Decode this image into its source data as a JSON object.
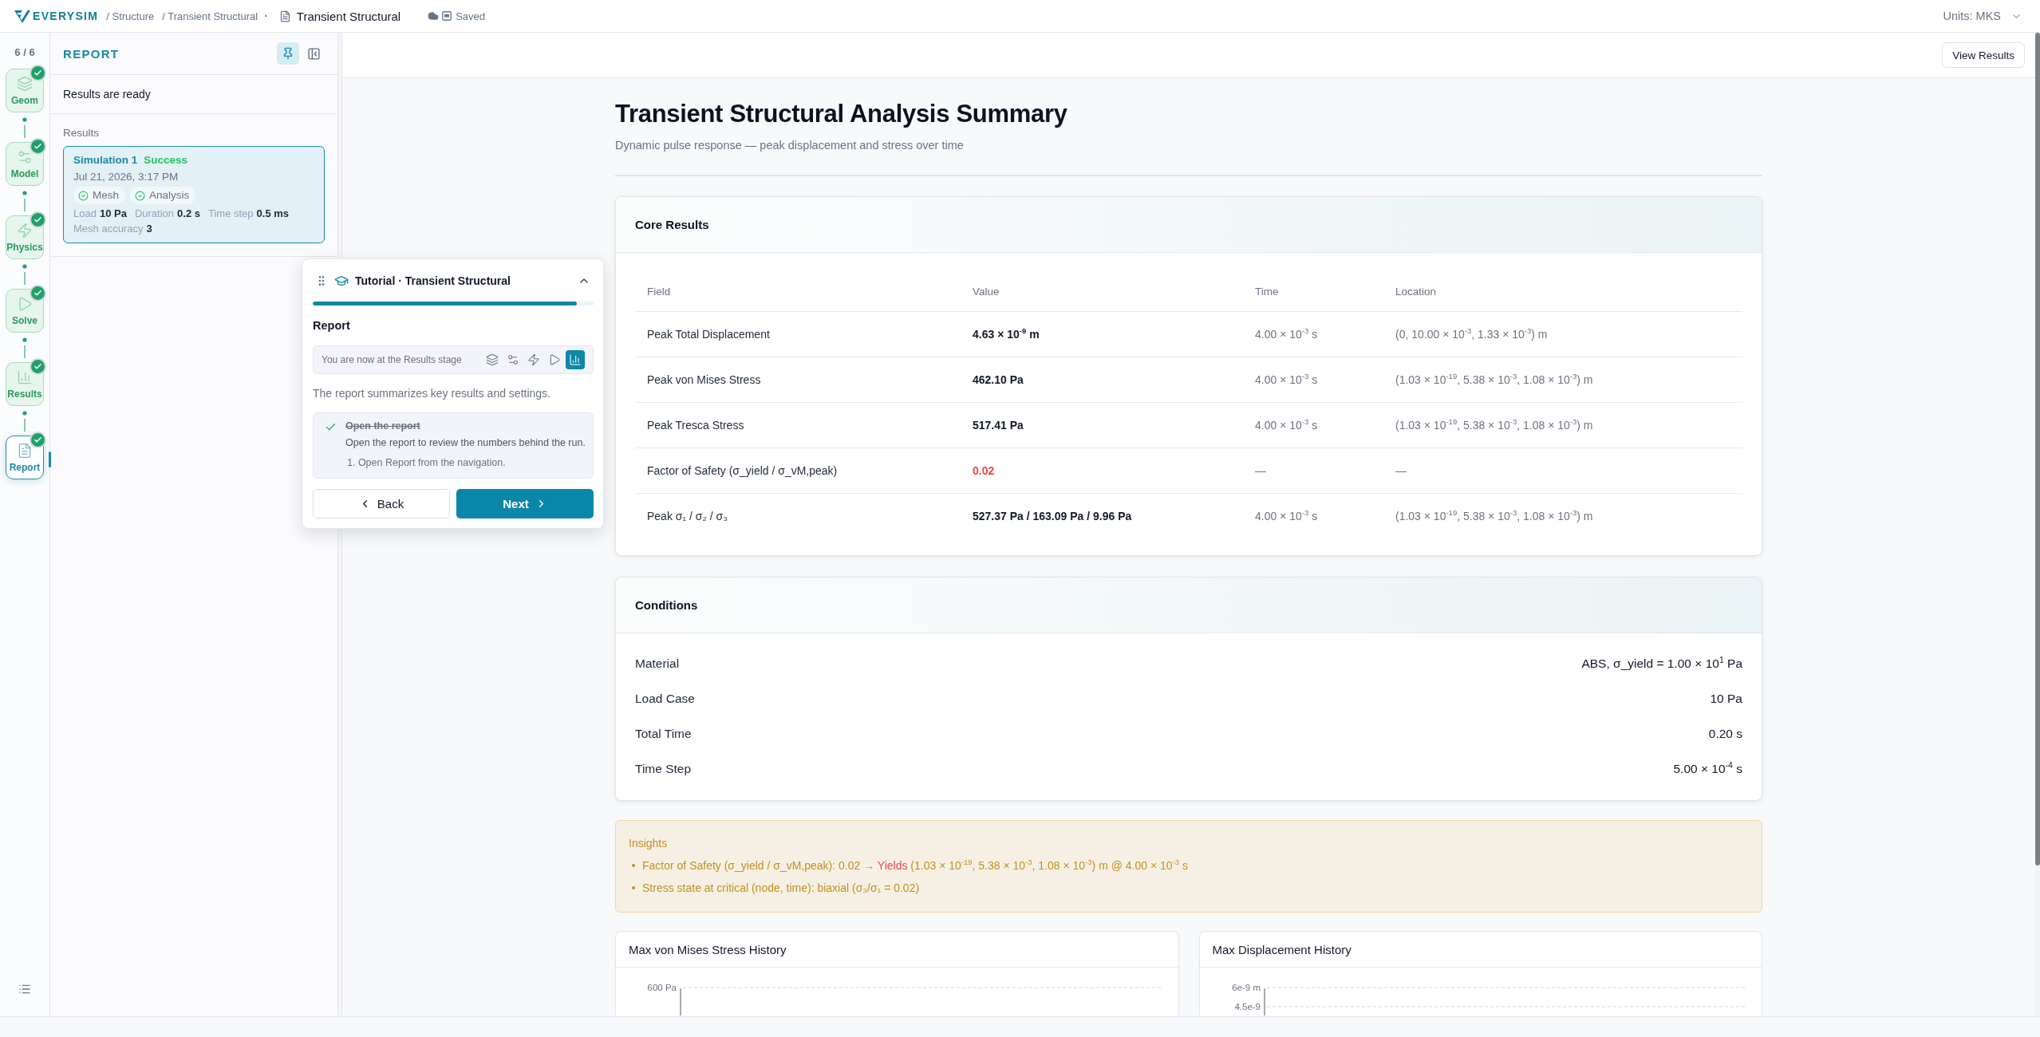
{
  "header": {
    "logo": "EVERYSIM",
    "breadcrumbs": [
      "/ Structure",
      "/ Transient Structural"
    ],
    "separator": "·",
    "document_title": "Transient Structural",
    "save_status": "Saved",
    "units": "Units: MKS"
  },
  "stepper": {
    "progress": "6 / 6",
    "steps": [
      {
        "label": "Geom",
        "done": true,
        "selected": false
      },
      {
        "label": "Model",
        "done": true,
        "selected": false
      },
      {
        "label": "Physics",
        "done": true,
        "selected": false
      },
      {
        "label": "Solve",
        "done": true,
        "selected": false
      },
      {
        "label": "Results",
        "done": true,
        "selected": false
      },
      {
        "label": "Report",
        "done": true,
        "selected": true
      }
    ]
  },
  "report_panel": {
    "title": "REPORT",
    "pinned": true,
    "status": "Results are ready",
    "section_label": "Results",
    "result_card": {
      "name": "Simulation 1",
      "status": "Success",
      "date": "Jul 21, 2026, 3:17 PM",
      "selected": true,
      "checks": [
        "Mesh",
        "Analysis"
      ],
      "metrics": [
        {
          "label": "Load",
          "value": "10 Pa"
        },
        {
          "label": "Duration",
          "value": "0.2 s"
        },
        {
          "label": "Time step",
          "value": "0.5 ms"
        },
        {
          "label": "Mesh accuracy",
          "value": "3"
        }
      ]
    }
  },
  "toolbar": {
    "button": "View Results"
  },
  "report": {
    "title": "Transient Structural Analysis Summary",
    "subtitle": "Dynamic pulse response — peak displacement and stress over time",
    "core_results": {
      "title": "Core Results",
      "columns": [
        "Field",
        "Value",
        "Time",
        "Location"
      ],
      "rows": [
        {
          "field": "Peak Total Displacement",
          "value": "4.63 × 10$^{-9}$ m",
          "time": "4.00 × 10$^{-3}$ s",
          "location": "(0, 10.00 × 10$^{-3}$, 1.33 × 10$^{-3}$) m",
          "critical": false
        },
        {
          "field": "Peak von Mises Stress",
          "value": "462.10 Pa",
          "time": "4.00 × 10$^{-3}$ s",
          "location": "(1.03 × 10$^{-19}$, 5.38 × 10$^{-3}$, 1.08 × 10$^{-3}$) m",
          "critical": false
        },
        {
          "field": "Peak Tresca Stress",
          "value": "517.41 Pa",
          "time": "4.00 × 10$^{-3}$ s",
          "location": "(1.03 × 10$^{-19}$, 5.38 × 10$^{-3}$, 1.08 × 10$^{-3}$) m",
          "critical": false
        },
        {
          "field": "Factor of Safety (σ_yield / σ_vM,peak)",
          "value": "0.02",
          "time": "—",
          "location": "—",
          "critical": true
        },
        {
          "field": "Peak σ₁ / σ₂ / σ₃",
          "value": "527.37 Pa / 163.09 Pa / 9.96 Pa",
          "time": "4.00 × 10$^{-3}$ s",
          "location": "(1.03 × 10$^{-19}$, 5.38 × 10$^{-3}$, 1.08 × 10$^{-3}$) m",
          "critical": false
        }
      ]
    },
    "conditions": {
      "title": "Conditions",
      "rows": [
        {
          "label": "Material",
          "value": "ABS, σ_yield = 1.00 × 10$^{1}$ Pa"
        },
        {
          "label": "Load Case",
          "value": "10 Pa"
        },
        {
          "label": "Total Time",
          "value": "0.20 s"
        },
        {
          "label": "Time Step",
          "value": "5.00 × 10$^{-4}$ s"
        }
      ]
    },
    "insights": {
      "title": "Insights",
      "items": [
        {
          "parts": [
            {
              "text": "Factor of Safety (σ_yield / σ_vM,peak): 0.02 → ",
              "alert": false
            },
            {
              "text": "Yields",
              "alert": true
            },
            {
              "text": " (1.03 × 10$^{-19}$, 5.38 × 10$^{-3}$, 1.08 × 10$^{-3}$) m @ 4.00 × 10$^{-3}$ s",
              "alert": false
            }
          ]
        },
        {
          "parts": [
            {
              "text": "Stress state at critical (node, time): biaxial (σ₃/σ₁ = 0.02)",
              "alert": false
            }
          ]
        }
      ]
    },
    "charts": [
      {
        "title": "Max von Mises Stress History",
        "y_tick_labels": [
          "600 Pa"
        ]
      },
      {
        "title": "Max Displacement History",
        "y_tick_labels": [
          "6e-9 m",
          "4.5e-9"
        ]
      }
    ]
  },
  "tutorial": {
    "title": "Tutorial · Transient Structural",
    "level": 0.94,
    "step_title": "Report",
    "stage_hint": "You are now at the Results stage",
    "stage_icons": [
      {
        "selected": false
      },
      {
        "selected": false
      },
      {
        "selected": false
      },
      {
        "selected": false
      },
      {
        "selected": true
      }
    ],
    "description": "The report summarizes key results and settings.",
    "task": {
      "title": "Open the report",
      "done": true,
      "text": "Open the report to review the numbers behind the run.",
      "steps": [
        "1. Open Report from the navigation."
      ]
    },
    "back": "Back",
    "next": "Next"
  }
}
